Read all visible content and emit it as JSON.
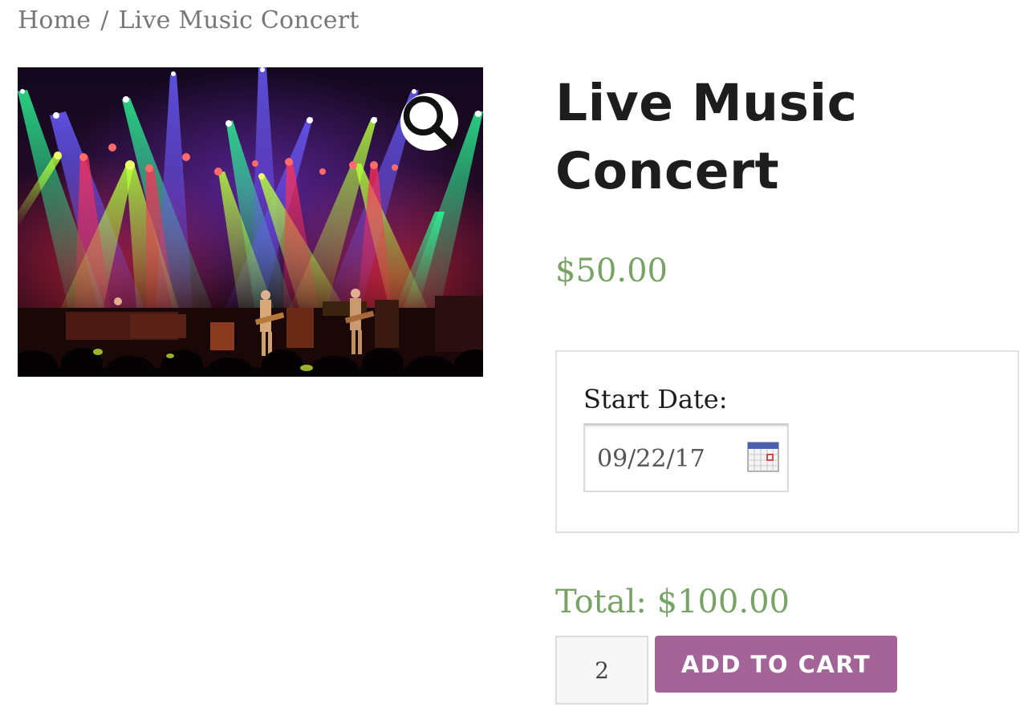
{
  "breadcrumb": {
    "home": "Home",
    "separator": "/",
    "current": "Live Music Concert"
  },
  "product": {
    "title": "Live Music Concert",
    "price": "$50.00",
    "image_icon": "zoom-magnifier-icon"
  },
  "addon": {
    "start_date_label": "Start Date:",
    "start_date_value": "09/22/17",
    "calendar_icon": "calendar-icon"
  },
  "cart": {
    "total": "Total: $100.00",
    "quantity": "2",
    "add_to_cart_label": "ADD TO CART"
  },
  "colors": {
    "price_green": "#77a464",
    "button_purple": "#a46497",
    "title_text": "#1d1d1d",
    "breadcrumb_text": "#777777"
  }
}
